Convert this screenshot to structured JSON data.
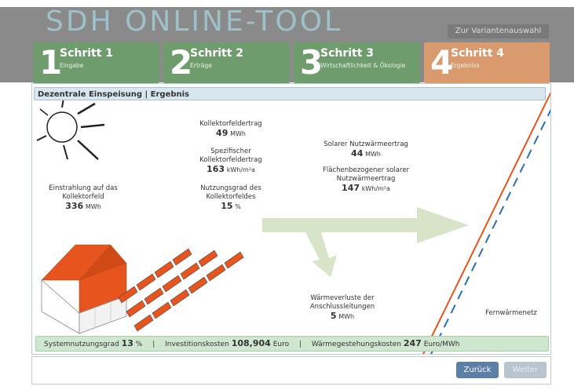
{
  "header": {
    "logo": "SDH ONLINE-TOOL",
    "variant_button": "Zur Variantenauswahl"
  },
  "steps": [
    {
      "num": "1",
      "title": "Schritt 1",
      "subtitle": "Eingabe",
      "state": "done"
    },
    {
      "num": "2",
      "title": "Schritt 2",
      "subtitle": "Erträge",
      "state": "done"
    },
    {
      "num": "3",
      "title": "Schritt 3",
      "subtitle": "Wirtschaftlichkeit & Ökologie",
      "state": "done"
    },
    {
      "num": "4",
      "title": "Schritt 4",
      "subtitle": "Ergebniss",
      "state": "active"
    }
  ],
  "panel": {
    "title": "Dezentrale Einspeisung | Ergebnis",
    "einstrahlung": {
      "label1": "Einstrahlung auf das",
      "label2": "Kollektorfeld",
      "value": "336",
      "unit": "MWh"
    },
    "kollektorfeldertrag": {
      "label": "Kollektorfeldertrag",
      "value": "49",
      "unit": "MWh"
    },
    "spezifisch": {
      "label1": "Spezifischer",
      "label2": "Kollektorfeldertrag",
      "value": "163",
      "unit": "kWh/m²a"
    },
    "nutzungsgrad": {
      "label1": "Nutzungsgrad des",
      "label2": "Kollektorfeldes",
      "value": "15",
      "unit": "%"
    },
    "solarer": {
      "label": "Solarer Nutzwärmeertrag",
      "value": "44",
      "unit": "MWh"
    },
    "flaechen": {
      "label1": "Flächenbezogener solarer",
      "label2": "Nutzwärmeertrag",
      "value": "147",
      "unit": "kWh/m²a"
    },
    "waermeverluste": {
      "label1": "Wärmeverluste der",
      "label2": "Anschlussleitungen",
      "value": "5",
      "unit": "MWh"
    },
    "fernwaermenetz": "Fernwärmenetz"
  },
  "status": {
    "systemnutzungsgrad_label": "Systemnutzungsgrad",
    "systemnutzungsgrad_value": "13",
    "systemnutzungsgrad_unit": "%",
    "invest_label": "Investitionskosten",
    "invest_value": "108,904",
    "invest_unit": "Euro",
    "waerme_label": "Wärmegestehungskosten",
    "waerme_value": "247",
    "waerme_unit": "Euro/MWh",
    "separator": "|"
  },
  "footer": {
    "back": "Zurück",
    "next": "Weiter"
  },
  "colors": {
    "step_done": "#6f9c6d",
    "step_active": "#d99a6d",
    "roof": "#e8541d",
    "arrow": "#d8e4c8",
    "red_line": "#e8541d",
    "blue_line": "#2a6fb5"
  }
}
